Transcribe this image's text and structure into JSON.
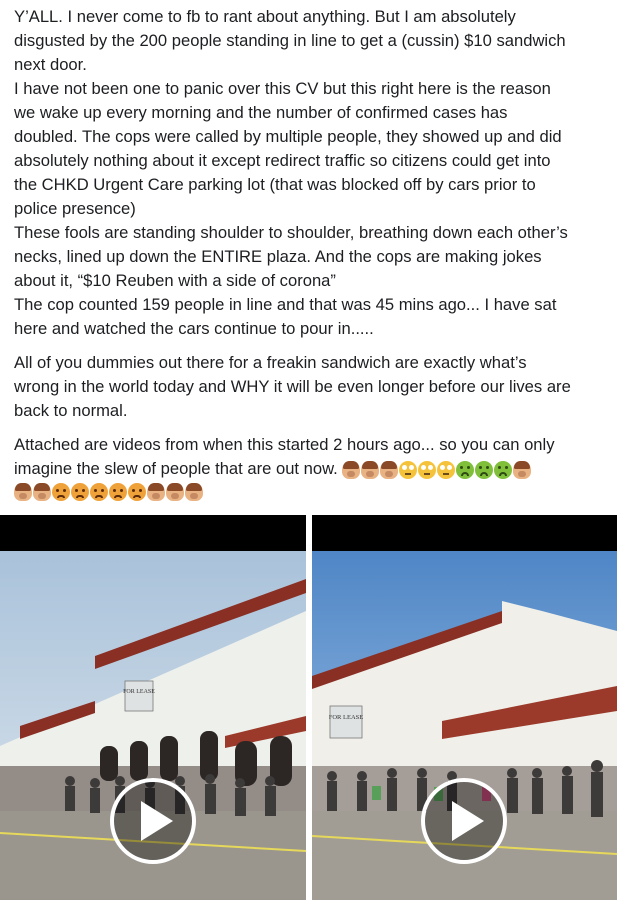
{
  "post": {
    "paragraphs": [
      {
        "lines": [
          "Y’ALL. I never come to fb to rant about anything. But I am absolutely",
          "disgusted by the 200 people standing in line to get a (cussin) $10 sandwich",
          "next door.",
          "I have not been one to panic over this CV but this right here is the reason",
          "we wake up every morning and the number of confirmed cases has",
          "doubled. The cops were called by multiple people, they showed up and did",
          "absolutely nothing about it except redirect traffic so citizens could get into",
          "the CHKD Urgent Care parking lot (that was blocked off by cars prior to",
          "police presence)",
          "These fools are standing shoulder to shoulder, breathing down each other’s",
          "necks, lined up down the ENTIRE plaza. And the cops are making jokes",
          "about it, “$10 Reuben with a side of corona”",
          "The cop counted 159 people in line and that was 45 mins ago... I have sat",
          "here and watched the cars continue to pour in....."
        ]
      },
      {
        "lines": [
          "All of you dummies out there for a freakin sandwich are exactly what’s",
          "wrong in the world today and WHY it will be even longer before our lives are",
          "back to normal."
        ]
      },
      {
        "lines": [
          "Attached are videos from when this started 2 hours ago... so you can only",
          "imagine the slew of people that are out now."
        ]
      }
    ],
    "emoji_line1": [
      "woman-facepalming-icon",
      "woman-facepalming-icon",
      "woman-facepalming-icon",
      "face-rolling-eyes-icon",
      "face-rolling-eyes-icon",
      "face-rolling-eyes-icon",
      "nauseated-face-icon",
      "nauseated-face-icon",
      "nauseated-face-icon",
      "woman-facepalming-icon"
    ],
    "emoji_line2": [
      "woman-facepalming-icon",
      "woman-facepalming-icon",
      "angry-face-icon",
      "angry-face-icon",
      "angry-face-icon",
      "angry-face-icon",
      "angry-face-icon",
      "woman-facepalming-icon",
      "woman-facepalming-icon",
      "woman-facepalming-icon"
    ]
  },
  "videos": [
    {
      "name": "video-1",
      "play_icon": "play-icon",
      "sign_text": "FOR LEASE"
    },
    {
      "name": "video-2",
      "play_icon": "play-icon",
      "sign_text": "FOR LEASE"
    }
  ],
  "colors": {
    "text": "#1c1e21",
    "letterbox": "#000000",
    "play": "#ffffff"
  }
}
